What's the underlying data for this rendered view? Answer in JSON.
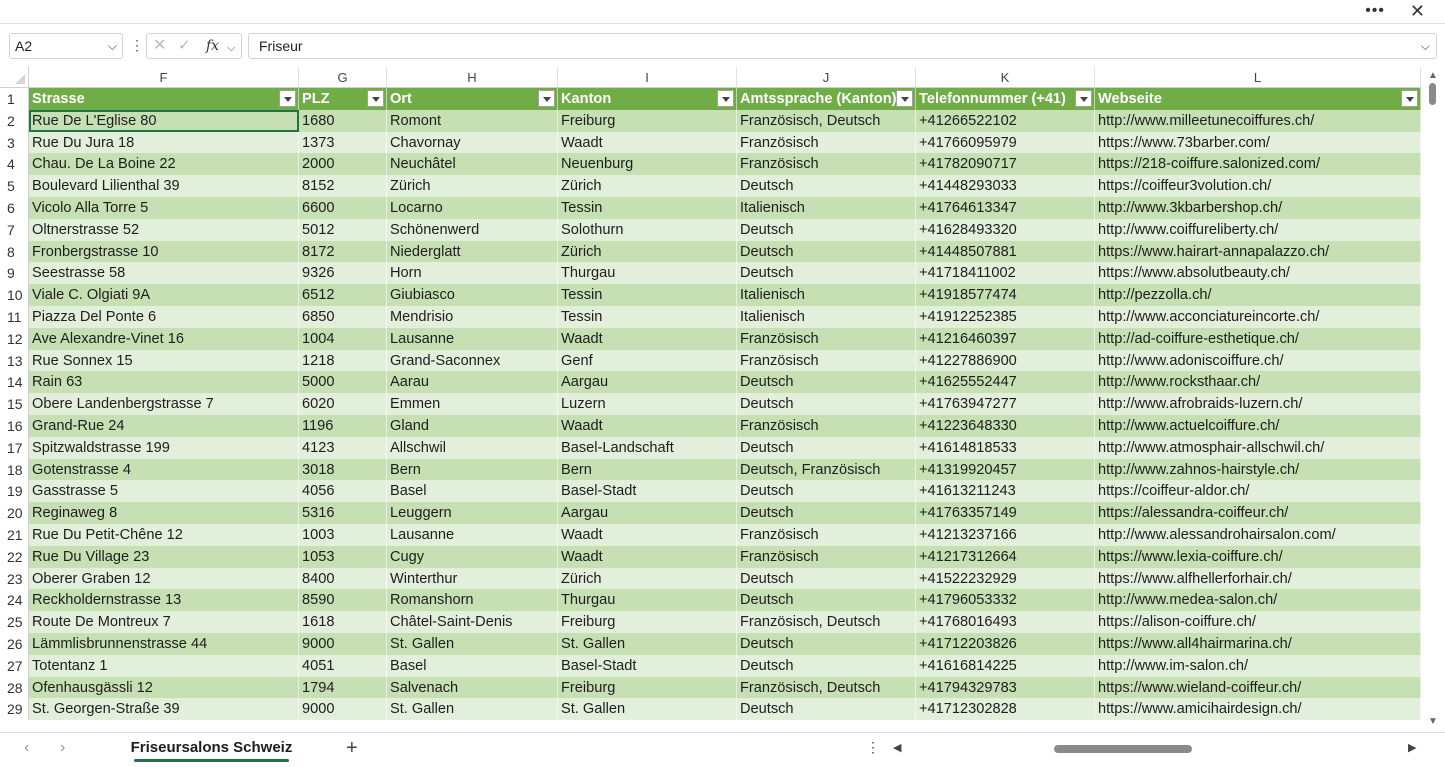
{
  "topbar": {
    "more_icon": "more-horizontal-icon",
    "close_icon": "close-icon"
  },
  "formula_bar": {
    "name_box": "A2",
    "formula": "Friseur",
    "fx_label": "fx"
  },
  "columns": [
    {
      "letter": "F",
      "header": "Strasse"
    },
    {
      "letter": "G",
      "header": "PLZ"
    },
    {
      "letter": "H",
      "header": "Ort"
    },
    {
      "letter": "I",
      "header": "Kanton"
    },
    {
      "letter": "J",
      "header": "Amtssprache (Kanton)"
    },
    {
      "letter": "K",
      "header": "Telefonnummer (+41)"
    },
    {
      "letter": "L",
      "header": "Webseite"
    }
  ],
  "header_row_number": "1",
  "rows": [
    {
      "n": "2",
      "cells": [
        "Rue De L'Eglise 80",
        "1680",
        "Romont",
        "Freiburg",
        "Französisch, Deutsch",
        "+41266522102",
        "http://www.milleetunecoiffures.ch/"
      ]
    },
    {
      "n": "3",
      "cells": [
        "Rue Du Jura 18",
        "1373",
        "Chavornay",
        "Waadt",
        "Französisch",
        "+41766095979",
        "https://www.73barber.com/"
      ]
    },
    {
      "n": "4",
      "cells": [
        "Chau. De La Boine 22",
        "2000",
        "Neuchâtel",
        "Neuenburg",
        "Französisch",
        "+41782090717",
        "https://218-coiffure.salonized.com/"
      ]
    },
    {
      "n": "5",
      "cells": [
        "Boulevard Lilienthal 39",
        "8152",
        "Zürich",
        "Zürich",
        "Deutsch",
        "+41448293033",
        "https://coiffeur3volution.ch/"
      ]
    },
    {
      "n": "6",
      "cells": [
        "Vicolo Alla Torre 5",
        "6600",
        "Locarno",
        "Tessin",
        "Italienisch",
        "+41764613347",
        "http://www.3kbarbershop.ch/"
      ]
    },
    {
      "n": "7",
      "cells": [
        "Oltnerstrasse 52",
        "5012",
        "Schönenwerd",
        "Solothurn",
        "Deutsch",
        "+41628493320",
        "http://www.coiffureliberty.ch/"
      ]
    },
    {
      "n": "8",
      "cells": [
        "Fronbergstrasse 10",
        "8172",
        "Niederglatt",
        "Zürich",
        "Deutsch",
        "+41448507881",
        "https://www.hairart-annapalazzo.ch/"
      ]
    },
    {
      "n": "9",
      "cells": [
        "Seestrasse 58",
        "9326",
        "Horn",
        "Thurgau",
        "Deutsch",
        "+41718411002",
        "https://www.absolutbeauty.ch/"
      ]
    },
    {
      "n": "10",
      "cells": [
        "Viale C. Olgiati 9A",
        "6512",
        "Giubiasco",
        "Tessin",
        "Italienisch",
        "+41918577474",
        "http://pezzolla.ch/"
      ]
    },
    {
      "n": "11",
      "cells": [
        "Piazza Del Ponte 6",
        "6850",
        "Mendrisio",
        "Tessin",
        "Italienisch",
        "+41912252385",
        "http://www.acconciatureincorte.ch/"
      ]
    },
    {
      "n": "12",
      "cells": [
        "Ave Alexandre-Vinet 16",
        "1004",
        "Lausanne",
        "Waadt",
        "Französisch",
        "+41216460397",
        "http://ad-coiffure-esthetique.ch/"
      ]
    },
    {
      "n": "13",
      "cells": [
        "Rue Sonnex 15",
        "1218",
        "Grand-Saconnex",
        "Genf",
        "Französisch",
        "+41227886900",
        "http://www.adoniscoiffure.ch/"
      ]
    },
    {
      "n": "14",
      "cells": [
        "Rain 63",
        "5000",
        "Aarau",
        "Aargau",
        "Deutsch",
        "+41625552447",
        "http://www.rocksthaar.ch/"
      ]
    },
    {
      "n": "15",
      "cells": [
        "Obere Landenbergstrasse 7",
        "6020",
        "Emmen",
        "Luzern",
        "Deutsch",
        "+41763947277",
        "http://www.afrobraids-luzern.ch/"
      ]
    },
    {
      "n": "16",
      "cells": [
        "Grand-Rue 24",
        "1196",
        "Gland",
        "Waadt",
        "Französisch",
        "+41223648330",
        "http://www.actuelcoiffure.ch/"
      ]
    },
    {
      "n": "17",
      "cells": [
        "Spitzwaldstrasse 199",
        "4123",
        "Allschwil",
        "Basel-Landschaft",
        "Deutsch",
        "+41614818533",
        "http://www.atmosphair-allschwil.ch/"
      ]
    },
    {
      "n": "18",
      "cells": [
        "Gotenstrasse 4",
        "3018",
        "Bern",
        "Bern",
        "Deutsch, Französisch",
        "+41319920457",
        "http://www.zahnos-hairstyle.ch/"
      ]
    },
    {
      "n": "19",
      "cells": [
        "Gasstrasse 5",
        "4056",
        "Basel",
        "Basel-Stadt",
        "Deutsch",
        "+41613211243",
        "https://coiffeur-aldor.ch/"
      ]
    },
    {
      "n": "20",
      "cells": [
        "Reginaweg 8",
        "5316",
        "Leuggern",
        "Aargau",
        "Deutsch",
        "+41763357149",
        "https://alessandra-coiffeur.ch/"
      ]
    },
    {
      "n": "21",
      "cells": [
        "Rue Du Petit-Chêne 12",
        "1003",
        "Lausanne",
        "Waadt",
        "Französisch",
        "+41213237166",
        "http://www.alessandrohairsalon.com/"
      ]
    },
    {
      "n": "22",
      "cells": [
        "Rue Du Village 23",
        "1053",
        "Cugy",
        "Waadt",
        "Französisch",
        "+41217312664",
        "https://www.lexia-coiffure.ch/"
      ]
    },
    {
      "n": "23",
      "cells": [
        "Oberer Graben 12",
        "8400",
        "Winterthur",
        "Zürich",
        "Deutsch",
        "+41522232929",
        "https://www.alfhellerforhair.ch/"
      ]
    },
    {
      "n": "24",
      "cells": [
        "Reckholdernstrasse 13",
        "8590",
        "Romanshorn",
        "Thurgau",
        "Deutsch",
        "+41796053332",
        "http://www.medea-salon.ch/"
      ]
    },
    {
      "n": "25",
      "cells": [
        "Route De Montreux 7",
        "1618",
        "Châtel-Saint-Denis",
        "Freiburg",
        "Französisch, Deutsch",
        "+41768016493",
        "https://alison-coiffure.ch/"
      ]
    },
    {
      "n": "26",
      "cells": [
        "Lämmlisbrunnenstrasse 44",
        "9000",
        "St. Gallen",
        "St. Gallen",
        "Deutsch",
        "+41712203826",
        "https://www.all4hairmarina.ch/"
      ]
    },
    {
      "n": "27",
      "cells": [
        "Totentanz 1",
        "4051",
        "Basel",
        "Basel-Stadt",
        "Deutsch",
        "+41616814225",
        "http://www.im-salon.ch/"
      ]
    },
    {
      "n": "28",
      "cells": [
        "Ofenhausgässli 12",
        "1794",
        "Salvenach",
        "Freiburg",
        "Französisch, Deutsch",
        "+41794329783",
        "https://www.wieland-coiffeur.ch/"
      ]
    },
    {
      "n": "29",
      "cells": [
        "St. Georgen-Straße 39",
        "9000",
        "St. Gallen",
        "St. Gallen",
        "Deutsch",
        "+41712302828",
        "https://www.amicihairdesign.ch/"
      ]
    }
  ],
  "sheet_tab": "Friseursalons Schweiz",
  "colors": {
    "header_green": "#70ad47",
    "band_dark": "#c6e0b4",
    "band_light": "#e2efda",
    "accent": "#217346"
  }
}
